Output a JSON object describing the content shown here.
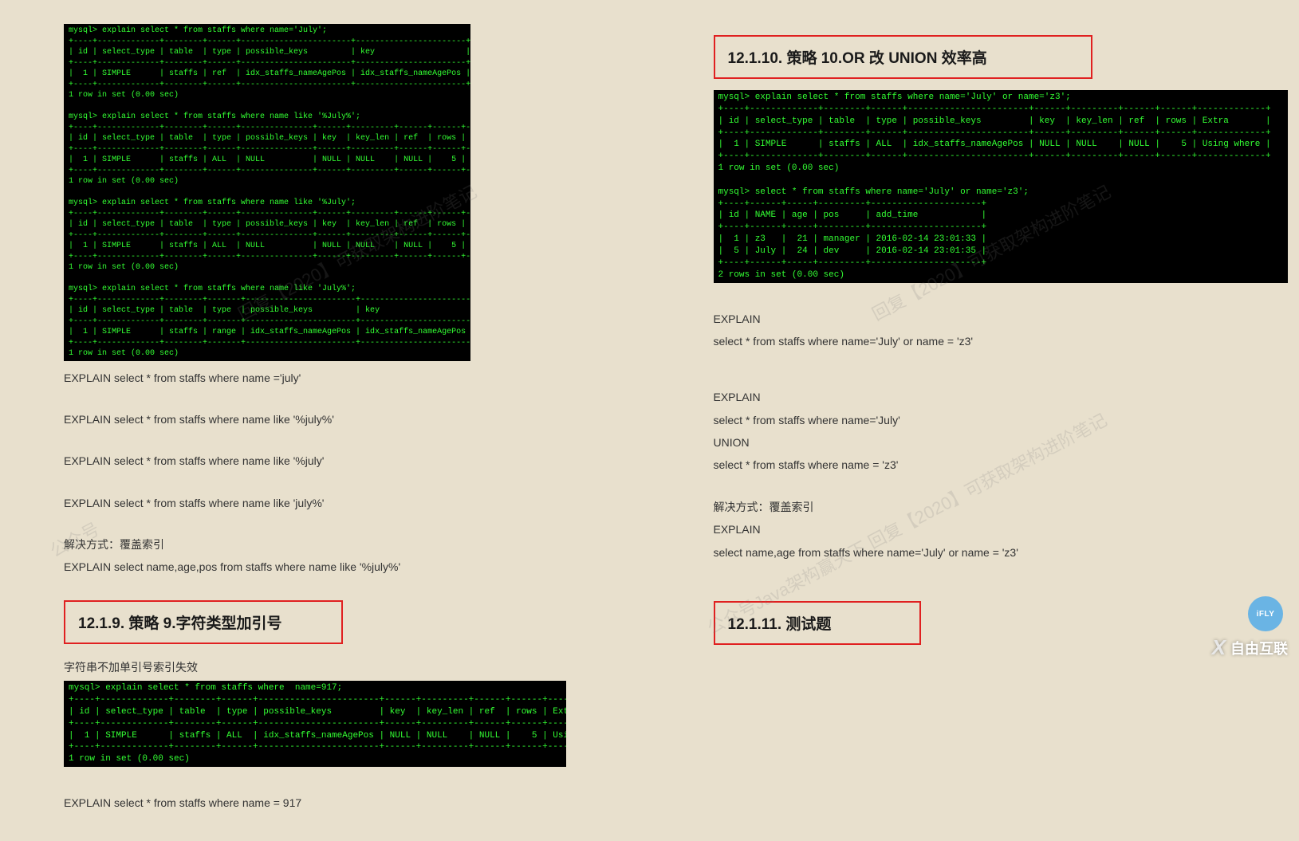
{
  "left": {
    "term1": "mysql> explain select * from staffs where name='July';\n+----+-------------+--------+------+-----------------------+-----------------------+---------+-------+------+-------------+\n| id | select_type | table  | type | possible_keys         | key                   | key_len | ref   | rows | Extra       |\n+----+-------------+--------+------+-----------------------+-----------------------+---------+-------+------+-------------+\n|  1 | SIMPLE      | staffs | ref  | idx_staffs_nameAgePos | idx_staffs_nameAgePos | 74      | const |    1 | Using where |\n+----+-------------+--------+------+-----------------------+-----------------------+---------+-------+------+-------------+\n1 row in set (0.00 sec)\n\nmysql> explain select * from staffs where name like '%July%';\n+----+-------------+--------+------+---------------+------+---------+------+------+-------------+\n| id | select_type | table  | type | possible_keys | key  | key_len | ref  | rows | Extra       |\n+----+-------------+--------+------+---------------+------+---------+------+------+-------------+\n|  1 | SIMPLE      | staffs | ALL  | NULL          | NULL | NULL    | NULL |    5 | Using where |\n+----+-------------+--------+------+---------------+------+---------+------+------+-------------+\n1 row in set (0.00 sec)\n\nmysql> explain select * from staffs where name like '%July';\n+----+-------------+--------+------+---------------+------+---------+------+------+-------------+\n| id | select_type | table  | type | possible_keys | key  | key_len | ref  | rows | Extra       |\n+----+-------------+--------+------+---------------+------+---------+------+------+-------------+\n|  1 | SIMPLE      | staffs | ALL  | NULL          | NULL | NULL    | NULL |    5 | Using where |\n+----+-------------+--------+------+---------------+------+---------+------+------+-------------+\n1 row in set (0.00 sec)\n\nmysql> explain select * from staffs where name like 'July%';\n+----+-------------+--------+-------+-----------------------+-----------------------+---------+------+------+-------------+\n| id | select_type | table  | type  | possible_keys         | key                   | key_len | ref  | rows | Extra       |\n+----+-------------+--------+-------+-----------------------+-----------------------+---------+------+------+-------------+\n|  1 | SIMPLE      | staffs | range | idx_staffs_nameAgePos | idx_staffs_nameAgePos | 74      | NULL |    1 | Using where |\n+----+-------------+--------+-------+-----------------------+-----------------------+---------+------+------+-------------+\n1 row in set (0.00 sec)",
    "p1": "EXPLAIN select * from staffs where name ='july'",
    "p2": "EXPLAIN select * from staffs where name like '%july%'",
    "p3": "EXPLAIN select * from staffs where name like '%july'",
    "p4": "EXPLAIN select * from staffs where name like 'july%'",
    "p5": "解决方式：覆盖索引",
    "p6": "EXPLAIN select name,age,pos from staffs where name like '%july%'",
    "h9": "12.1.9.    策略 9.字符类型加引号",
    "p7": "字符串不加单引号索引失效",
    "term2": "mysql> explain select * from staffs where  name=917;\n+----+-------------+--------+------+-----------------------+------+---------+------+------+-------------+\n| id | select_type | table  | type | possible_keys         | key  | key_len | ref  | rows | Extra       |\n+----+-------------+--------+------+-----------------------+------+---------+------+------+-------------+\n|  1 | SIMPLE      | staffs | ALL  | idx_staffs_nameAgePos | NULL | NULL    | NULL |    5 | Using where |\n+----+-------------+--------+------+-----------------------+------+---------+------+------+-------------+\n1 row in set (0.00 sec)",
    "p8": "EXPLAIN select * from staffs where name = 917"
  },
  "right": {
    "h10": "12.1.10.   策略 10.OR 改 UNION 效率高",
    "term1": "mysql> explain select * from staffs where name='July' or name='z3';\n+----+-------------+--------+------+-----------------------+------+---------+------+------+-------------+\n| id | select_type | table  | type | possible_keys         | key  | key_len | ref  | rows | Extra       |\n+----+-------------+--------+------+-----------------------+------+---------+------+------+-------------+\n|  1 | SIMPLE      | staffs | ALL  | idx_staffs_nameAgePos | NULL | NULL    | NULL |    5 | Using where |\n+----+-------------+--------+------+-----------------------+------+---------+------+------+-------------+\n1 row in set (0.00 sec)\n\nmysql> select * from staffs where name='July' or name='z3';\n+----+------+-----+---------+---------------------+\n| id | NAME | age | pos     | add_time            |\n+----+------+-----+---------+---------------------+\n|  1 | z3   |  21 | manager | 2016-02-14 23:01:33 |\n|  5 | July |  24 | dev     | 2016-02-14 23:01:35 |\n+----+------+-----+---------+---------------------+\n2 rows in set (0.00 sec)",
    "p1": "EXPLAIN",
    "p2": "select * from staffs where name='July' or name = 'z3'",
    "p3": "EXPLAIN",
    "p4": "select * from staffs where name='July'",
    "p5": "UNION",
    "p6": "select * from staffs where    name = 'z3'",
    "p7": "解决方式：覆盖索引",
    "p8": "EXPLAIN",
    "p9": "select name,age from staffs where name='July' or name = 'z3'",
    "h11": "12.1.11.   测试题"
  },
  "watermarks": {
    "wm1": "回复【2020】可获取架构进阶笔记",
    "wm2": "公众号Java架构赢天下  回复【2020】可获取架构进阶笔记",
    "wm3": "公众号"
  },
  "footer": {
    "logo_text": "自由互联",
    "badge_text": "iFLY"
  }
}
